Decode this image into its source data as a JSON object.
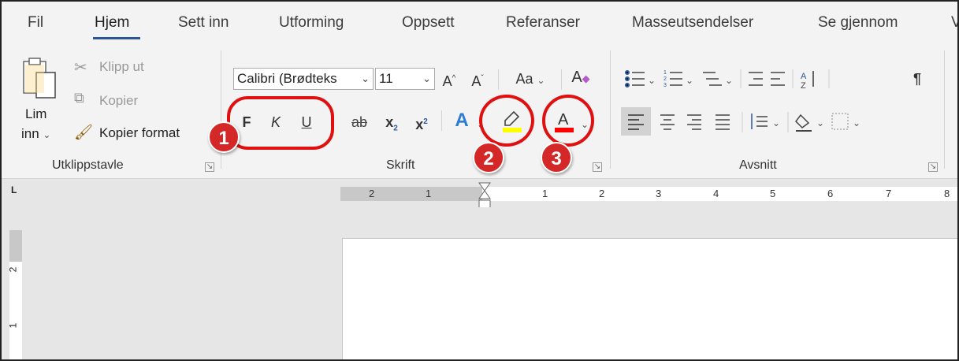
{
  "tabs": [
    "Fil",
    "Hjem",
    "Sett inn",
    "Utforming",
    "Oppsett",
    "Referanser",
    "Masseutsendelser",
    "Se gjennom",
    "V"
  ],
  "clipboard": {
    "paste_label": "Lim",
    "paste_label2": "inn",
    "cut": "Klipp ut",
    "copy": "Kopier",
    "format_painter": "Kopier format",
    "group": "Utklippstavle"
  },
  "font": {
    "font_name": "Calibri (Brødteks",
    "font_size": "11",
    "bold": "F",
    "italic": "K",
    "underline": "U",
    "strike": "ab",
    "change_case": "Aa",
    "group": "Skrift"
  },
  "paragraph": {
    "group": "Avsnitt",
    "pilcrow": "¶"
  },
  "callouts": [
    "1",
    "2",
    "3"
  ],
  "ruler": {
    "h_labels": [
      "2",
      "1",
      "1",
      "2",
      "3",
      "4",
      "5",
      "6",
      "7",
      "8"
    ],
    "v_labels": [
      "2",
      "1"
    ]
  },
  "colors": {
    "accent": "#2b579a",
    "highlight": "#ffff00",
    "font_color": "#ff0000",
    "callout": "#d42727"
  }
}
